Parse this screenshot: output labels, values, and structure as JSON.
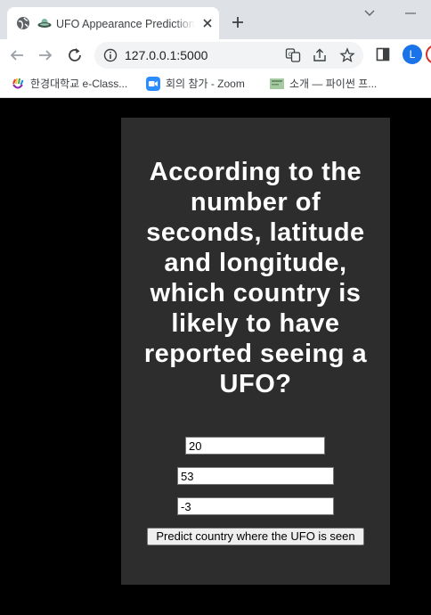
{
  "browser": {
    "tab_title": "UFO Appearance Prediction",
    "url": "127.0.0.1:5000",
    "profile_initial": "L",
    "bookmarks": [
      {
        "label": "한경대학교 e-Class..."
      },
      {
        "label": "회의 참가 - Zoom"
      },
      {
        "label": "소개 — 파이썬 프..."
      }
    ]
  },
  "page": {
    "heading": "According to the number of seconds, latitude and longitude, which country is likely to have reported seeing a UFO?",
    "form": {
      "seconds_value": "20",
      "latitude_value": "53",
      "longitude_value": "-3",
      "submit_label": "Predict country where the UFO is seen"
    }
  },
  "colors": {
    "page_background": "#000000",
    "card_background": "#2d2d2d",
    "heading_text": "#ffffff",
    "profile_accent": "#1a73e8"
  }
}
